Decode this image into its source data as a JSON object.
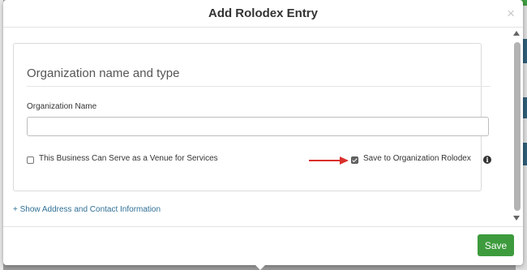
{
  "modal": {
    "title": "Add Rolodex Entry",
    "close_label": "×"
  },
  "section": {
    "title": "Organization name and type"
  },
  "org_name": {
    "label": "Organization Name",
    "value": "",
    "placeholder": ""
  },
  "venue_checkbox": {
    "label": "This Business Can Serve as a Venue for Services",
    "checked": false
  },
  "save_rolodex_checkbox": {
    "label": "Save to Organization Rolodex",
    "checked": true,
    "info_glyph": "i"
  },
  "links": {
    "show_address": "+ Show Address and Contact Information"
  },
  "footer": {
    "save_label": "Save"
  },
  "colors": {
    "save_button": "#3d9b3d",
    "link": "#2f6f95",
    "annotation_arrow": "#d9302c"
  },
  "icons": {
    "close": "close-icon",
    "info": "info-icon",
    "arrow": "red-arrow-icon"
  }
}
